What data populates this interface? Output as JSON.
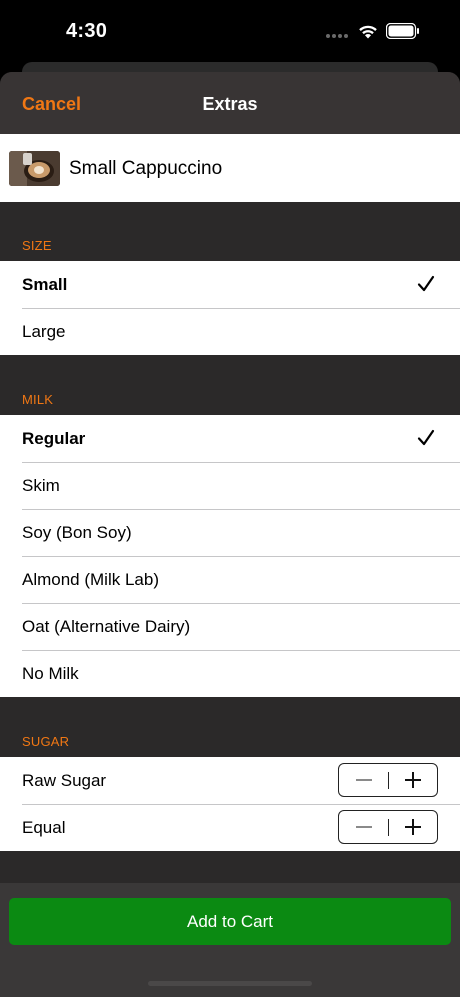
{
  "status_bar": {
    "time": "4:30"
  },
  "nav": {
    "cancel_label": "Cancel",
    "title": "Extras"
  },
  "product": {
    "name": "Small Cappuccino",
    "image_icon": "cappuccino-photo"
  },
  "sections": {
    "size": {
      "header": "SIZE",
      "options": [
        {
          "label": "Small",
          "selected": true
        },
        {
          "label": "Large",
          "selected": false
        }
      ]
    },
    "milk": {
      "header": "MILK",
      "options": [
        {
          "label": "Regular",
          "selected": true
        },
        {
          "label": "Skim",
          "selected": false
        },
        {
          "label": "Soy (Bon Soy)",
          "selected": false
        },
        {
          "label": "Almond (Milk Lab)",
          "selected": false
        },
        {
          "label": "Oat (Alternative Dairy)",
          "selected": false
        },
        {
          "label": "No Milk",
          "selected": false
        }
      ]
    },
    "sugar": {
      "header": "SUGAR",
      "items": [
        {
          "label": "Raw Sugar"
        },
        {
          "label": "Equal"
        }
      ]
    }
  },
  "footer": {
    "add_to_cart_label": "Add to Cart"
  },
  "colors": {
    "accent": "#f07714",
    "button": "#0b8a12",
    "sheet": "#2b2929"
  }
}
